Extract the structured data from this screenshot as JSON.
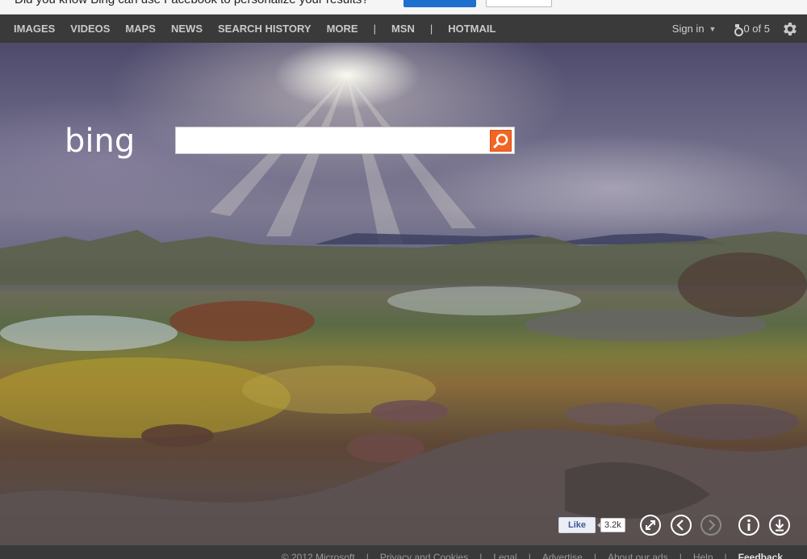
{
  "notice": {
    "text": "Did you know Bing can use Facebook to personalize your results?"
  },
  "nav": {
    "items": [
      "IMAGES",
      "VIDEOS",
      "MAPS",
      "NEWS",
      "SEARCH HISTORY",
      "MORE"
    ],
    "separator": "|",
    "extra": [
      "MSN",
      "HOTMAIL"
    ]
  },
  "account": {
    "signin_label": "Sign in",
    "rewards_label": "0 of 5"
  },
  "search": {
    "logo_text": "bing",
    "query": "",
    "button_icon": "search-icon"
  },
  "social": {
    "like_label": "Like",
    "like_count": "3.2k"
  },
  "controls": {
    "icons": [
      "fullscreen-icon",
      "previous-icon",
      "next-icon",
      "info-icon",
      "download-icon"
    ]
  },
  "footer": {
    "copyright": "© 2012 Microsoft",
    "links": [
      "Privacy and Cookies",
      "Legal",
      "Advertise",
      "About our ads",
      "Help"
    ],
    "feedback": "Feedback"
  },
  "colors": {
    "nav_bar": "#3a3a3a",
    "search_button": "#f26522",
    "like_text": "#3b5998"
  }
}
